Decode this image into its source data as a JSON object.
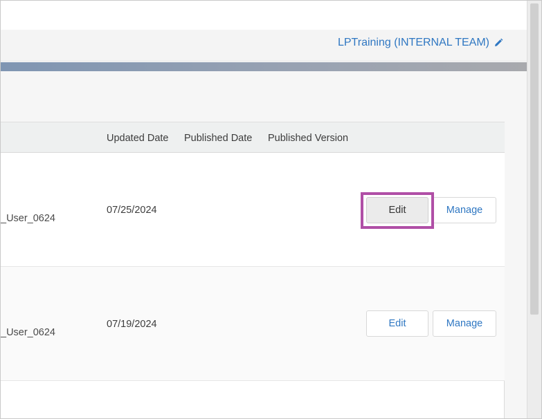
{
  "header": {
    "org_name": "LPTraining (INTERNAL TEAM)",
    "edit_icon": "pencil-icon"
  },
  "table": {
    "columns": [
      "Updated Date",
      "Published Date",
      "Published Version"
    ],
    "rows": [
      {
        "owner": "_User_0624",
        "updated_date": "07/25/2024",
        "published_date": "",
        "published_version": "",
        "edit_label": "Edit",
        "manage_label": "Manage",
        "edit_highlighted": true
      },
      {
        "owner": "_User_0624",
        "updated_date": "07/19/2024",
        "published_date": "",
        "published_version": "",
        "edit_label": "Edit",
        "manage_label": "Manage",
        "edit_highlighted": false
      }
    ]
  },
  "colors": {
    "link": "#2f77c2",
    "highlight": "#b04fa6"
  }
}
